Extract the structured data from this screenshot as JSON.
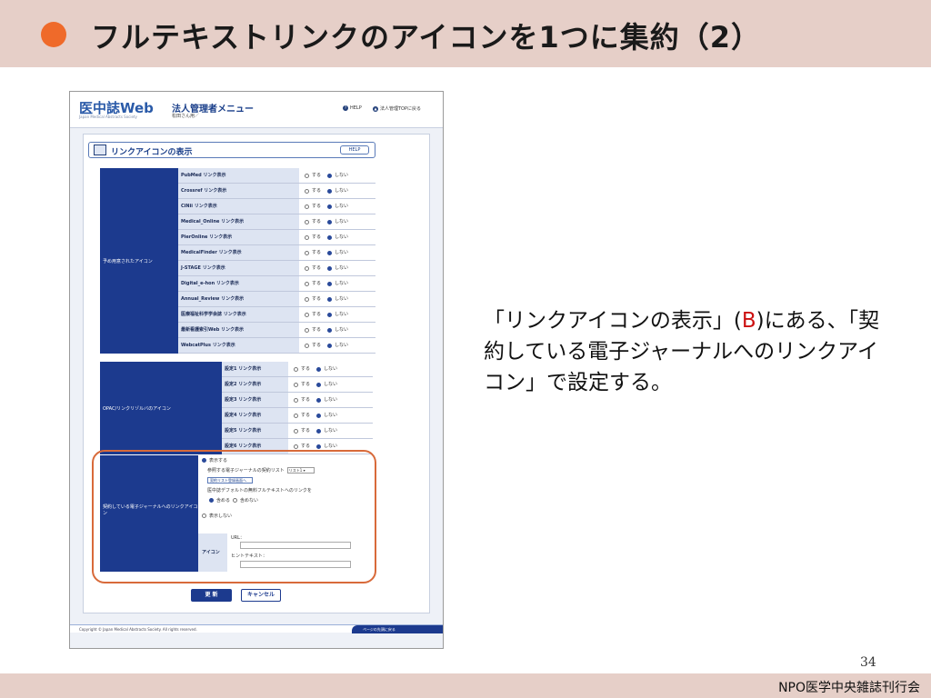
{
  "slide": {
    "title": "フルテキストリンクのアイコンを1つに集約（2）",
    "description_pre": "「リンクアイコンの表示」(",
    "description_hl": "B",
    "description_post": ")にある、「契約している電子ジャーナルへのリンクアイコン」で設定する。",
    "page_number": "34",
    "footer": "NPO医学中央雑誌刊行会",
    "accent_color": "#ef6a2a",
    "band_color": "#e6cfc8",
    "highlight_color": "#cc1111"
  },
  "screenshot": {
    "logo": "医中誌Web",
    "logo_sub": "Japan Medical Abstracts Society",
    "menu_title": "法人管理者メニュー",
    "menu_user": "松田さん用／",
    "help_link": "HELP",
    "top_link": "法人管理TOPに戻る",
    "section_title": "リンクアイコンの表示",
    "section_help": "HELP",
    "option_on": "する",
    "option_off": "しない",
    "group1_label": "予め用意されたアイコン",
    "group1_rows": [
      "PubMed リンク表示",
      "Crossref リンク表示",
      "CiNii リンク表示",
      "Medical_Online リンク表示",
      "PierOnline リンク表示",
      "MedicalFinder リンク表示",
      "J-STAGE リンク表示",
      "Digital_e-hon リンク表示",
      "Annual_Review リンク表示",
      "医療福祉科学学会誌 リンク表示",
      "最新看護索引Web リンク表示",
      "WebcatPlus リンク表示"
    ],
    "group2_label": "OPAC/リンクリゾルバのアイコン",
    "group2_rows": [
      "設定1 リンク表示",
      "設定2 リンク表示",
      "設定3 リンク表示",
      "設定4 リンク表示",
      "設定5 リンク表示",
      "設定6 リンク表示"
    ],
    "contract": {
      "label": "契約している電子ジャーナルへのリンクアイコン",
      "show": "表示する",
      "ref_list_label": "参照する電子ジャーナルの契約リスト",
      "ref_list_value": "リスト1",
      "register_button": "契約リスト登録画面へ",
      "default_free_label": "医中誌デフォルトの無料フルテキストへのリンクを",
      "include": "含める",
      "exclude": "含めない",
      "hide": "表示しない",
      "icon_label": "アイコン",
      "url_label": "URL：",
      "hint_label": "ヒントテキスト："
    },
    "update_button": "更 新",
    "cancel_button": "キャンセル",
    "copyright": "Copyright © Japan Medical Abstracts Society. All rights reserved.",
    "page_top": "ページの先頭に戻る"
  }
}
